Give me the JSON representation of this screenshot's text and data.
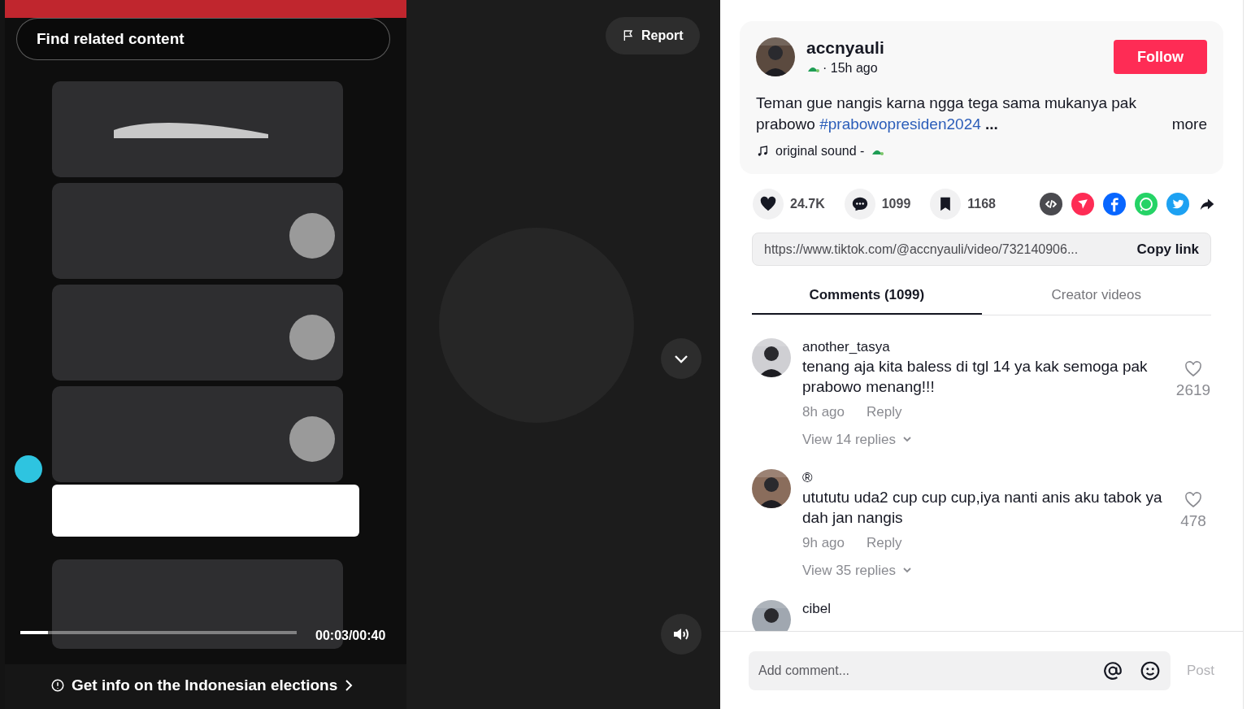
{
  "video": {
    "related_search": "Find related content",
    "report": "Report",
    "progress": {
      "level": 0.1
    },
    "time": "00:03/00:40",
    "info_banner": "Get info on the Indonesian elections"
  },
  "post": {
    "username": "accnyauli",
    "time": "· 15h ago",
    "follow": "Follow",
    "description": "Teman gue nangis karna ngga tega sama mukanya pak prabowo",
    "hashtag": "#prabowopresiden2024",
    "ellipsis": "...",
    "more": "more",
    "sound": "original sound -"
  },
  "stats": [
    {
      "kind": "like",
      "count": "24.7K"
    },
    {
      "kind": "comment",
      "count": "1099"
    },
    {
      "kind": "bookmark",
      "count": "1168"
    }
  ],
  "share": [
    {
      "kind": "embed",
      "color": "#4a4a4f"
    },
    {
      "kind": "send",
      "color": "#fe2c55"
    },
    {
      "kind": "facebook",
      "color": "#0866ff"
    },
    {
      "kind": "whatsapp",
      "color": "#25d366"
    },
    {
      "kind": "twitter",
      "color": "#1da1f2"
    },
    {
      "kind": "forward",
      "color": "#161823"
    }
  ],
  "link": {
    "url": "https://www.tiktok.com/@accnyauli/video/732140906...",
    "copy": "Copy link"
  },
  "tabs": [
    {
      "label": "Comments (1099)",
      "selected": true
    },
    {
      "label": "Creator videos",
      "selected": false
    }
  ],
  "comments": [
    {
      "user": "another_tasya",
      "text": "tenang aja kita baless di tgl 14 ya kak semoga pak prabowo menang!!!",
      "time": "8h ago",
      "reply": "Reply",
      "likes": "2619",
      "replies": "View 14 replies"
    },
    {
      "user": "®",
      "text": "utututu uda2 cup cup cup,iya nanti anis aku tabok ya dah jan nangis",
      "time": "9h ago",
      "reply": "Reply",
      "likes": "478",
      "replies": "View 35 replies"
    },
    {
      "user": "cibel"
    }
  ],
  "composer": {
    "placeholder": "Add comment...",
    "post": "Post",
    "post_disabled": true
  }
}
